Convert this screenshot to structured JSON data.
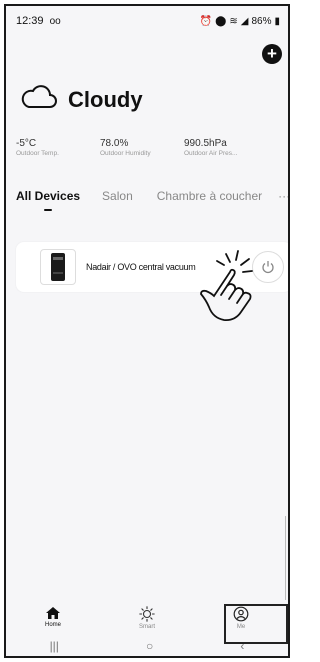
{
  "status_bar": {
    "time": "12:39",
    "battery": "86%"
  },
  "weather": {
    "condition": "Cloudy",
    "stats": [
      {
        "value": "-5°C",
        "label": "Outdoor Temp."
      },
      {
        "value": "78.0%",
        "label": "Outdoor Humidity"
      },
      {
        "value": "990.5hPa",
        "label": "Outdoor Air Pres..."
      }
    ]
  },
  "tabs": [
    {
      "label": "All Devices",
      "active": true
    },
    {
      "label": "Salon",
      "active": false
    },
    {
      "label": "Chambre à coucher",
      "active": false
    }
  ],
  "tabs_more": "···",
  "devices": [
    {
      "name": "Nadair / OVO central vacuum"
    }
  ],
  "bottom_nav": [
    {
      "label": "Home",
      "icon": "home-icon",
      "active": true
    },
    {
      "label": "Smart",
      "icon": "sun-icon",
      "active": false
    },
    {
      "label": "Me",
      "icon": "profile-icon",
      "active": false
    }
  ],
  "system_nav": {
    "recents": "|||",
    "home": "○",
    "back": "‹"
  },
  "colors": {
    "accent": "#111111",
    "background": "#f6f6f8",
    "card": "#ffffff"
  }
}
